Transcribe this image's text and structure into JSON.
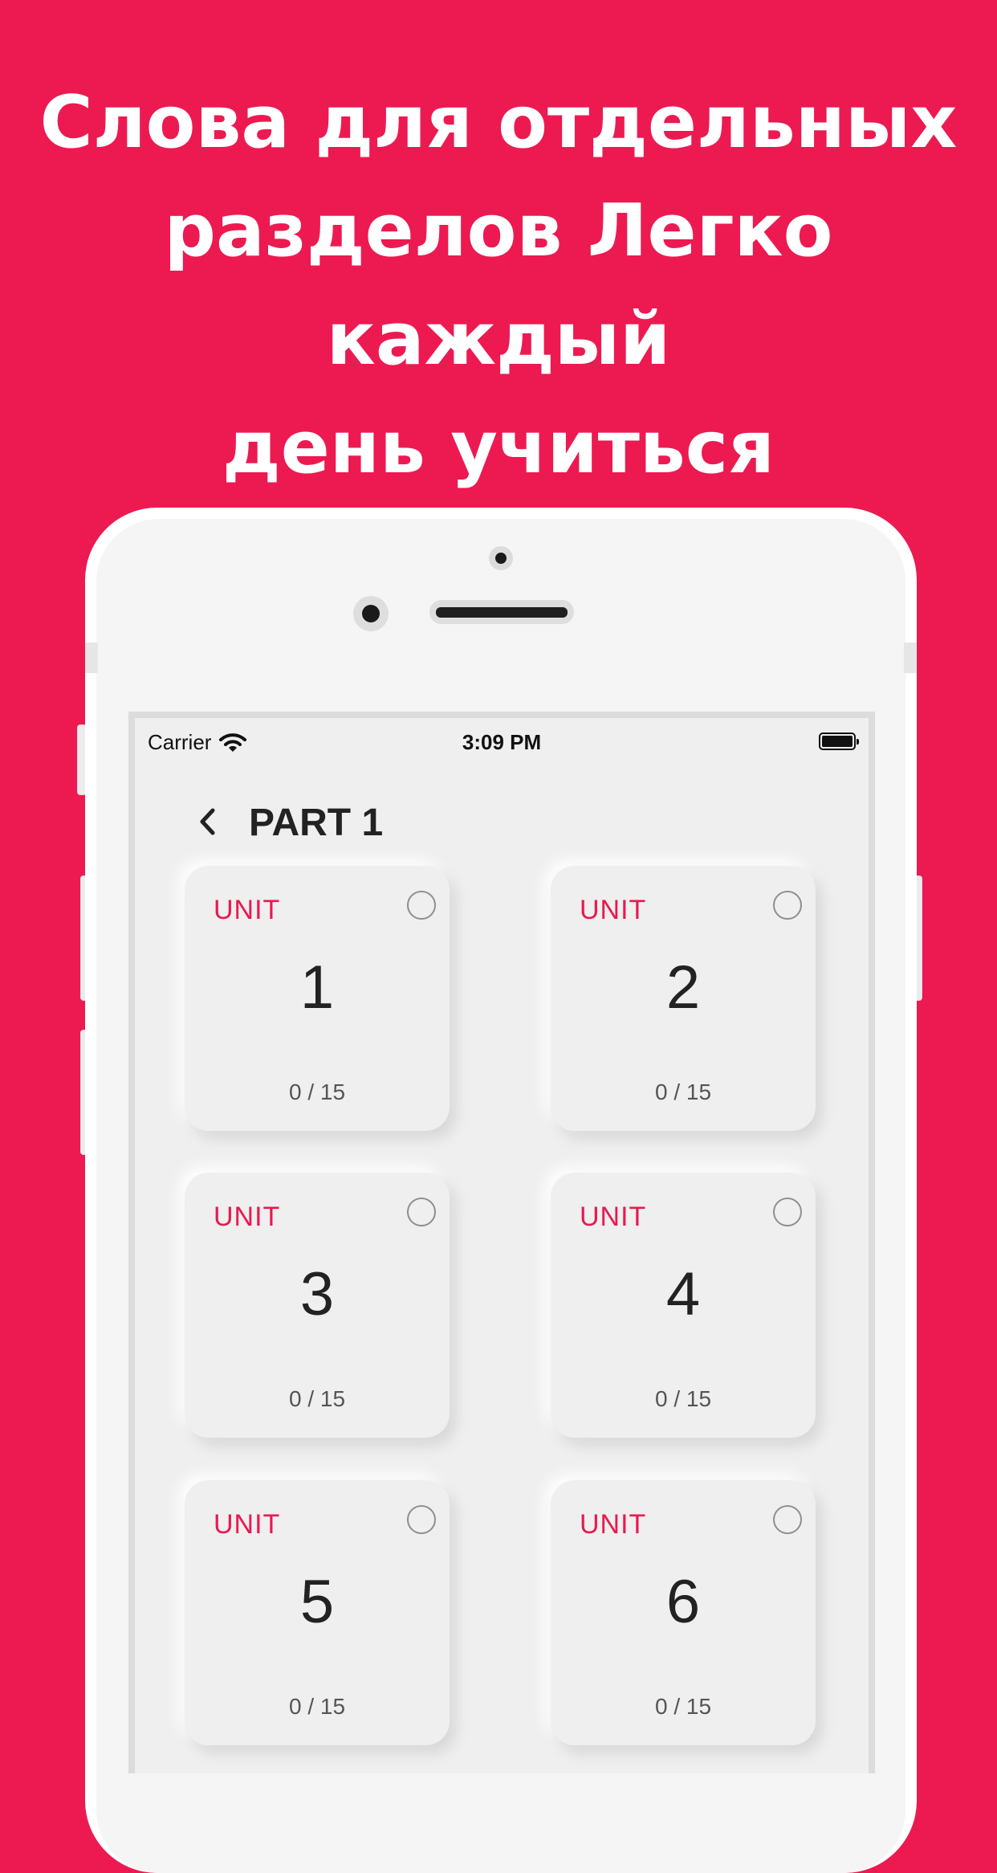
{
  "colors": {
    "background": "#ec1a51",
    "accent": "#e8194f",
    "screen_bg": "#efefef"
  },
  "headline": {
    "line1": "Слова для отдельных",
    "line2": "разделов Легко каждый",
    "line3": "день учиться"
  },
  "status_bar": {
    "carrier": "Carrier",
    "time": "3:09 PM",
    "wifi_icon": "wifi-icon",
    "battery_icon": "battery-icon"
  },
  "nav": {
    "back_icon": "chevron-left-icon",
    "title": "PART 1"
  },
  "units": [
    {
      "label": "UNIT",
      "number": "1",
      "progress": "0 / 15"
    },
    {
      "label": "UNIT",
      "number": "2",
      "progress": "0 / 15"
    },
    {
      "label": "UNIT",
      "number": "3",
      "progress": "0 / 15"
    },
    {
      "label": "UNIT",
      "number": "4",
      "progress": "0 / 15"
    },
    {
      "label": "UNIT",
      "number": "5",
      "progress": "0 / 15"
    },
    {
      "label": "UNIT",
      "number": "6",
      "progress": "0 / 15"
    }
  ]
}
